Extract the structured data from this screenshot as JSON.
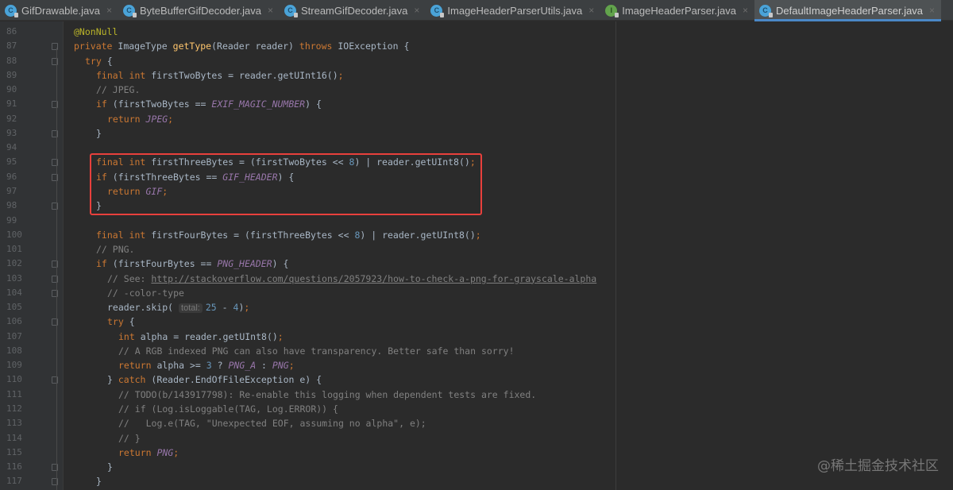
{
  "tabs": [
    {
      "label": "GifDrawable.java",
      "icon": "class-icon",
      "active": false
    },
    {
      "label": "ByteBufferGifDecoder.java",
      "icon": "class-icon",
      "active": false
    },
    {
      "label": "StreamGifDecoder.java",
      "icon": "class-icon",
      "active": false
    },
    {
      "label": "ImageHeaderParserUtils.java",
      "icon": "class-icon",
      "active": false
    },
    {
      "label": "ImageHeaderParser.java",
      "icon": "interface-icon",
      "active": false
    },
    {
      "label": "DefaultImageHeaderParser.java",
      "icon": "class-icon",
      "active": true
    }
  ],
  "colors": {
    "keyword": "#cc7832",
    "method": "#ffc66d",
    "number": "#6897bb",
    "constant": "#9876aa",
    "comment": "#808080",
    "highlight": "#e8403c"
  },
  "lines": [
    {
      "n": "86",
      "i": 0,
      "t": [
        [
          "an",
          "@NonNull"
        ]
      ]
    },
    {
      "n": "87",
      "i": 0,
      "t": [
        [
          "kw",
          "private "
        ],
        [
          "p",
          "ImageType "
        ],
        [
          "fn",
          "getType"
        ],
        [
          "p",
          "(Reader reader) "
        ],
        [
          "kw",
          "throws "
        ],
        [
          "p",
          "IOException {"
        ]
      ]
    },
    {
      "n": "88",
      "i": 1,
      "t": [
        [
          "kw",
          "try "
        ],
        [
          "p",
          "{"
        ]
      ]
    },
    {
      "n": "89",
      "i": 2,
      "t": [
        [
          "kw",
          "final int "
        ],
        [
          "p",
          "firstTwoBytes = reader.getUInt16()"
        ],
        [
          "kw",
          ";"
        ]
      ]
    },
    {
      "n": "90",
      "i": 2,
      "t": [
        [
          "cm",
          "// JPEG."
        ]
      ]
    },
    {
      "n": "91",
      "i": 2,
      "t": [
        [
          "kw",
          "if "
        ],
        [
          "p",
          "(firstTwoBytes == "
        ],
        [
          "cst",
          "EXIF_MAGIC_NUMBER"
        ],
        [
          "p",
          ") {"
        ]
      ]
    },
    {
      "n": "92",
      "i": 3,
      "t": [
        [
          "kw",
          "return "
        ],
        [
          "cst",
          "JPEG"
        ],
        [
          "kw",
          ";"
        ]
      ]
    },
    {
      "n": "93",
      "i": 2,
      "t": [
        [
          "p",
          "}"
        ]
      ]
    },
    {
      "n": "94",
      "i": 0,
      "t": []
    },
    {
      "n": "95",
      "i": 2,
      "t": [
        [
          "kw",
          "final int "
        ],
        [
          "p",
          "firstThreeBytes = (firstTwoBytes << "
        ],
        [
          "num",
          "8"
        ],
        [
          "p",
          ") | reader.getUInt8()"
        ],
        [
          "kw",
          ";"
        ]
      ]
    },
    {
      "n": "96",
      "i": 2,
      "t": [
        [
          "kw",
          "if "
        ],
        [
          "p",
          "(firstThreeBytes == "
        ],
        [
          "cst",
          "GIF_HEADER"
        ],
        [
          "p",
          ") {"
        ]
      ]
    },
    {
      "n": "97",
      "i": 3,
      "t": [
        [
          "kw",
          "return "
        ],
        [
          "cst",
          "GIF"
        ],
        [
          "kw",
          ";"
        ]
      ]
    },
    {
      "n": "98",
      "i": 2,
      "t": [
        [
          "p",
          "}"
        ]
      ]
    },
    {
      "n": "99",
      "i": 0,
      "t": []
    },
    {
      "n": "100",
      "i": 2,
      "t": [
        [
          "kw",
          "final int "
        ],
        [
          "p",
          "firstFourBytes = (firstThreeBytes << "
        ],
        [
          "num",
          "8"
        ],
        [
          "p",
          ") | reader.getUInt8()"
        ],
        [
          "kw",
          ";"
        ]
      ]
    },
    {
      "n": "101",
      "i": 2,
      "t": [
        [
          "cm",
          "// PNG."
        ]
      ]
    },
    {
      "n": "102",
      "i": 2,
      "t": [
        [
          "kw",
          "if "
        ],
        [
          "p",
          "(firstFourBytes == "
        ],
        [
          "cst",
          "PNG_HEADER"
        ],
        [
          "p",
          ") {"
        ]
      ]
    },
    {
      "n": "103",
      "i": 3,
      "t": [
        [
          "cm",
          "// See: "
        ],
        [
          "url",
          "http://stackoverflow.com/questions/2057923/how-to-check-a-png-for-grayscale-alpha"
        ]
      ]
    },
    {
      "n": "104",
      "i": 3,
      "t": [
        [
          "cm",
          "// -color-type"
        ]
      ]
    },
    {
      "n": "105",
      "i": 3,
      "t": [
        [
          "p",
          "reader.skip( "
        ],
        [
          "hint",
          "total:"
        ],
        [
          "num",
          "25 "
        ],
        [
          "p",
          "- "
        ],
        [
          "num",
          "4"
        ],
        [
          "p",
          ")"
        ],
        [
          "kw",
          ";"
        ]
      ]
    },
    {
      "n": "106",
      "i": 3,
      "t": [
        [
          "kw",
          "try "
        ],
        [
          "p",
          "{"
        ]
      ]
    },
    {
      "n": "107",
      "i": 4,
      "t": [
        [
          "kw",
          "int "
        ],
        [
          "p",
          "alpha = reader.getUInt8()"
        ],
        [
          "kw",
          ";"
        ]
      ]
    },
    {
      "n": "108",
      "i": 4,
      "t": [
        [
          "cm",
          "// A RGB indexed PNG can also have transparency. Better safe than sorry!"
        ]
      ]
    },
    {
      "n": "109",
      "i": 4,
      "t": [
        [
          "kw",
          "return "
        ],
        [
          "p",
          "alpha >= "
        ],
        [
          "num",
          "3 "
        ],
        [
          "p",
          "? "
        ],
        [
          "cst",
          "PNG_A "
        ],
        [
          "p",
          ": "
        ],
        [
          "cst",
          "PNG"
        ],
        [
          "kw",
          ";"
        ]
      ]
    },
    {
      "n": "110",
      "i": 3,
      "t": [
        [
          "p",
          "} "
        ],
        [
          "kw",
          "catch "
        ],
        [
          "p",
          "(Reader.EndOfFileException e) {"
        ]
      ]
    },
    {
      "n": "111",
      "i": 4,
      "t": [
        [
          "cm",
          "// TODO(b/143917798): Re-enable this logging when dependent tests are fixed."
        ]
      ]
    },
    {
      "n": "112",
      "i": 4,
      "t": [
        [
          "cm",
          "// if (Log.isLoggable(TAG, Log.ERROR)) {"
        ]
      ]
    },
    {
      "n": "113",
      "i": 4,
      "t": [
        [
          "cm",
          "//   Log.e(TAG, \"Unexpected EOF, assuming no alpha\", e);"
        ]
      ]
    },
    {
      "n": "114",
      "i": 4,
      "t": [
        [
          "cm",
          "// }"
        ]
      ]
    },
    {
      "n": "115",
      "i": 4,
      "t": [
        [
          "kw",
          "return "
        ],
        [
          "cst",
          "PNG"
        ],
        [
          "kw",
          ";"
        ]
      ]
    },
    {
      "n": "116",
      "i": 3,
      "t": [
        [
          "p",
          "}"
        ]
      ]
    },
    {
      "n": "117",
      "i": 2,
      "t": [
        [
          "p",
          "}"
        ]
      ]
    }
  ],
  "folds": [
    "87",
    "88",
    "91",
    "93",
    "95",
    "96",
    "98",
    "102",
    "103",
    "104",
    "106",
    "110",
    "116",
    "117"
  ],
  "watermark": "@稀土掘金技术社区"
}
